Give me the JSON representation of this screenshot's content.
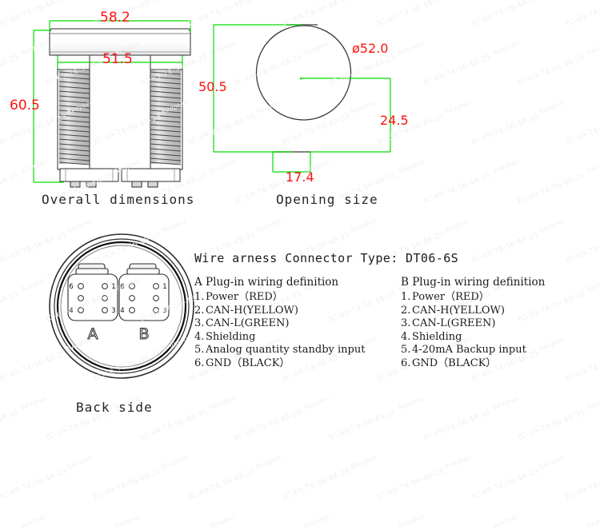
{
  "drawing": {
    "title_views": {
      "overall": "Overall dimensions",
      "opening": "Opening size",
      "back": "Back side"
    },
    "colors": {
      "dimension_text": "#ff1111",
      "dimension_line": "#00dd00",
      "outline": "#2b2b2b",
      "caption": "#262626"
    }
  },
  "overall_dimensions": {
    "width_top": "58.2",
    "width_thread": "51.5",
    "height": "60.5"
  },
  "opening_size": {
    "diameter": "ø52.0",
    "height_left": "50.5",
    "offset_right": "24.5",
    "flat_width": "17.4"
  },
  "back_side": {
    "connector_a_label": "A",
    "connector_b_label": "B",
    "pin_numbers": [
      "6",
      "1",
      "4",
      "3"
    ]
  },
  "wiring": {
    "header": "Wire arness Connector Type: DT06-6S",
    "columns": [
      {
        "title": "A Plug-in wiring definition",
        "pins": [
          {
            "n": "1.",
            "t": "Power（RED）"
          },
          {
            "n": "2.",
            "t": "CAN-H(YELLOW)"
          },
          {
            "n": "3.",
            "t": "CAN-L(GREEN)"
          },
          {
            "n": "4.",
            "t": "Shielding"
          },
          {
            "n": "5.",
            "t": "Analog quantity standby input"
          },
          {
            "n": "6.",
            "t": "GND（BLACK）"
          }
        ]
      },
      {
        "title": "B Plug-in wiring definition",
        "pins": [
          {
            "n": "1.",
            "t": "Power（RED）"
          },
          {
            "n": "2.",
            "t": "CAN-H(YELLOW)"
          },
          {
            "n": "3.",
            "t": "CAN-L(GREEN)"
          },
          {
            "n": "4.",
            "t": "Shielding"
          },
          {
            "n": "5.",
            "t": "4-20mA Backup input"
          },
          {
            "n": "6.",
            "t": "GND（BLACK）"
          }
        ]
      }
    ]
  },
  "watermark": {
    "code": "IC-69-74-56-48-25",
    "brand": "Seaptec"
  }
}
